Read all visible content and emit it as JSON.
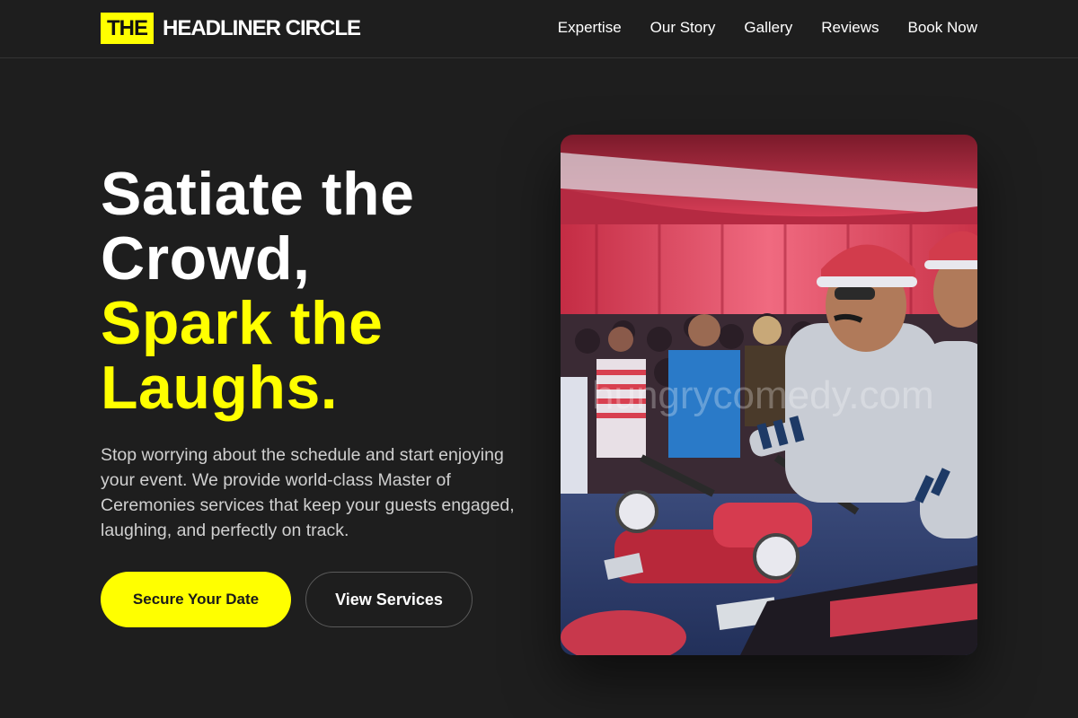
{
  "brand": {
    "badge": "THE",
    "name": "HEADLINER CIRCLE",
    "accent_color": "#ffff00"
  },
  "nav": {
    "items": [
      "Expertise",
      "Our Story",
      "Gallery",
      "Reviews",
      "Book Now"
    ]
  },
  "hero": {
    "title_line_1": "Satiate the",
    "title_line_2": "Crowd,",
    "title_line_3": "Spark the",
    "title_line_4": "Laughs.",
    "description": "Stop worrying about the schedule and start enjoying your event. We provide world-class Master of Ceremonies services that keep your guests engaged, laughing, and perfectly on track.",
    "primary_cta": "Secure Your Date",
    "secondary_cta": "View Services"
  },
  "image": {
    "watermark": "hungrycomedy.com"
  }
}
